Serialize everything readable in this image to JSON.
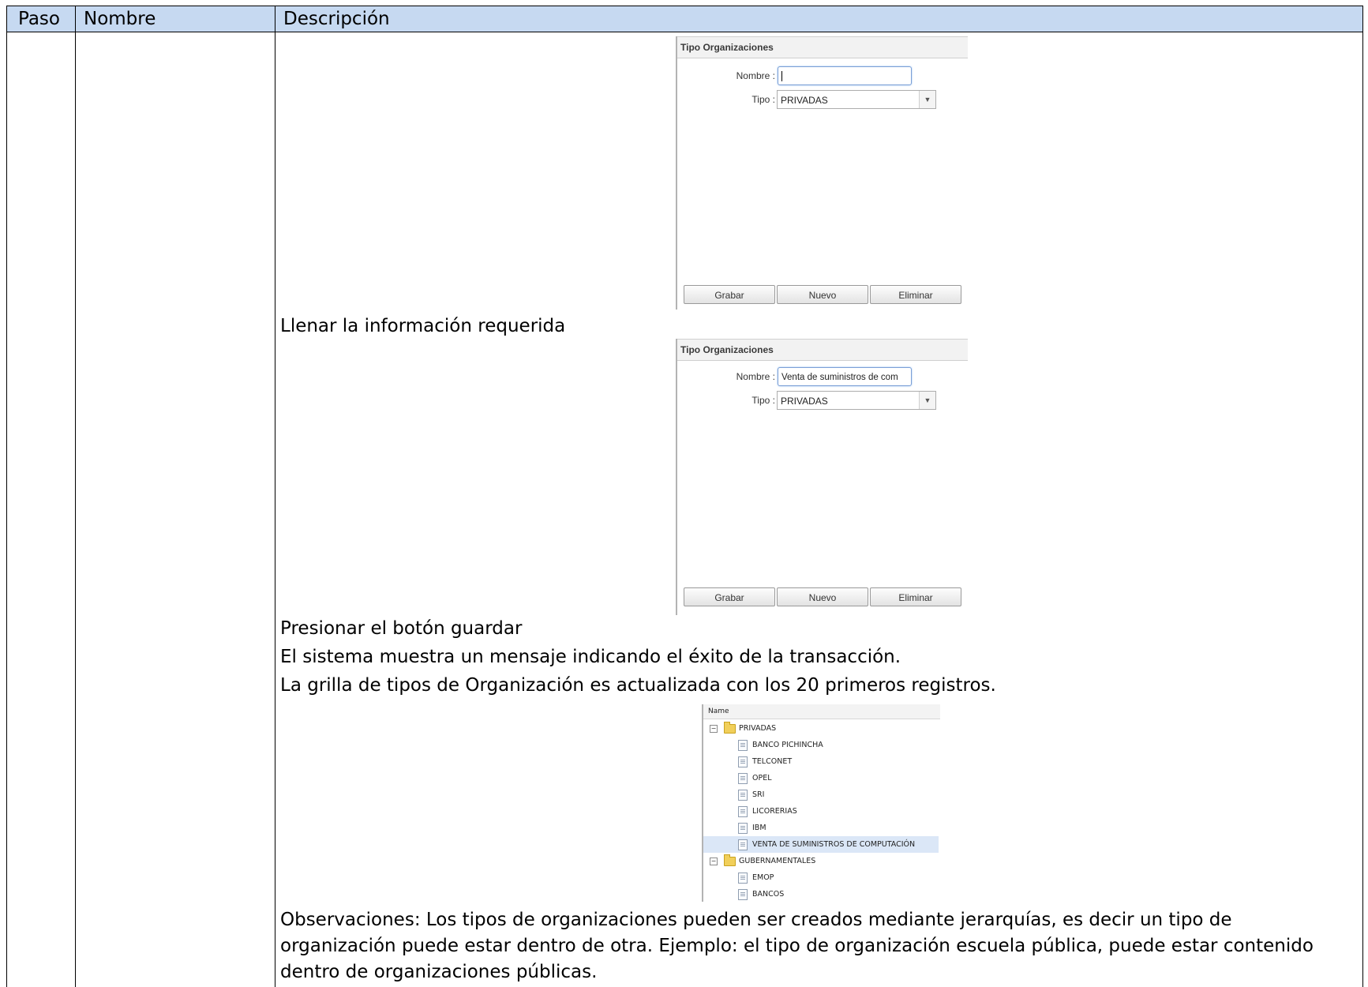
{
  "table": {
    "headers": {
      "paso": "Paso",
      "nombre": "Nombre",
      "descripcion": "Descripción"
    }
  },
  "panel_top": {
    "title": "Tipo Organizaciones",
    "nombre_label": "Nombre :",
    "nombre_value": "",
    "tipo_label": "Tipo :",
    "tipo_value": "PRIVADAS",
    "buttons": {
      "grabar": "Grabar",
      "nuevo": "Nuevo",
      "eliminar": "Eliminar"
    }
  },
  "step1": "Llenar la información requerida",
  "panel_filled": {
    "title": "Tipo Organizaciones",
    "nombre_label": "Nombre :",
    "nombre_value": "Venta de suministros de com",
    "tipo_label": "Tipo :",
    "tipo_value": "PRIVADAS",
    "buttons": {
      "grabar": "Grabar",
      "nuevo": "Nuevo",
      "eliminar": "Eliminar"
    }
  },
  "step2": "Presionar el botón guardar",
  "step3": "El sistema muestra un mensaje indicando el éxito de la transacción.",
  "step4": "La grilla de tipos de Organización es actualizada con los 20 primeros registros.",
  "tree": {
    "header": "Name",
    "nodes": [
      {
        "label": "PRIVADAS",
        "kind": "folder"
      },
      {
        "label": "BANCO PICHINCHA",
        "kind": "leaf"
      },
      {
        "label": "TELCONET",
        "kind": "leaf"
      },
      {
        "label": "OPEL",
        "kind": "leaf"
      },
      {
        "label": "SRI",
        "kind": "leaf"
      },
      {
        "label": "LICORERIAS",
        "kind": "leaf"
      },
      {
        "label": "IBM",
        "kind": "leaf"
      },
      {
        "label": "VENTA DE SUMINISTROS DE COMPUTACIÓN",
        "kind": "leaf",
        "selected": true
      },
      {
        "label": "GUBERNAMENTALES",
        "kind": "folder"
      },
      {
        "label": "EMOP",
        "kind": "leaf"
      },
      {
        "label": "BANCOS",
        "kind": "leaf"
      }
    ]
  },
  "observaciones": {
    "line1": "Observaciones: Los tipos de organizaciones pueden ser creados mediante jerarquías, es decir un tipo de",
    "line2": "organización puede estar dentro de otra. Ejemplo: el tipo de organización escuela pública, puede estar contenido",
    "line3": "dentro de organizaciones públicas."
  }
}
